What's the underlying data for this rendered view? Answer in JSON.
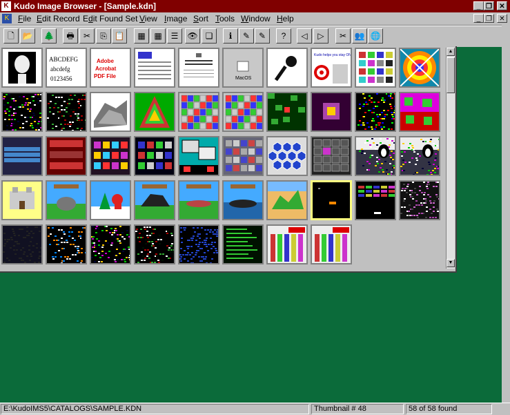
{
  "titlebar": {
    "title": "Kudo Image Browser - [Sample.kdn]",
    "minimize": "_",
    "restore": "❐",
    "close": "✕"
  },
  "menubar": {
    "items": [
      "File",
      "Edit Record",
      "Edit Found Set",
      "View",
      "Image",
      "Sort",
      "Tools",
      "Window",
      "Help"
    ],
    "mnemonics": [
      "F",
      "E",
      "d",
      "V",
      "I",
      "S",
      "T",
      "W",
      "H"
    ],
    "doc_minimize": "_",
    "doc_restore": "❐",
    "doc_close": "✕"
  },
  "toolbar": {
    "buttons": [
      {
        "name": "new-file",
        "glyph": "🗋"
      },
      {
        "name": "open-folder",
        "glyph": "📂"
      },
      {
        "name": "catalog",
        "glyph": "🌲"
      },
      {
        "name": "print",
        "glyph": "🖶"
      },
      {
        "name": "cut",
        "glyph": "✂"
      },
      {
        "name": "copy",
        "glyph": "⎘"
      },
      {
        "name": "paste",
        "glyph": "📋"
      },
      {
        "name": "thumbnail-view-large",
        "glyph": "▦"
      },
      {
        "name": "thumbnail-view-small",
        "glyph": "▦"
      },
      {
        "name": "list-view",
        "glyph": "☰"
      },
      {
        "name": "view-image",
        "glyph": "👁"
      },
      {
        "name": "stack",
        "glyph": "❏"
      },
      {
        "name": "info",
        "glyph": "ℹ"
      },
      {
        "name": "wand",
        "glyph": "✎"
      },
      {
        "name": "edit-pencil",
        "glyph": "✎"
      },
      {
        "name": "help-question",
        "glyph": "?"
      },
      {
        "name": "find-prev",
        "glyph": "◁"
      },
      {
        "name": "find-next",
        "glyph": "▷"
      },
      {
        "name": "tools",
        "glyph": "✂"
      },
      {
        "name": "people",
        "glyph": "👥"
      },
      {
        "name": "globe",
        "glyph": "🌐"
      }
    ]
  },
  "thumbnails": {
    "items": [
      "Einstein portrait",
      "Typeface sample",
      "Adobe Acrobat PDF File",
      "Document page",
      "Kudo Browser Multimedia Suite",
      "MacOS",
      "Microphone",
      "Kudo helps you stay ON TARGET!",
      "Color swatches",
      "Color wheel",
      "Dark noise game screen",
      "Dark noise game screen",
      "3D terrain",
      "Pyramid game",
      "Colored grid game",
      "Colored grid game",
      "Green maze",
      "Purple maze",
      "Colored confetti",
      "Green shapes puzzle",
      "Blue grid game",
      "Red bricks game",
      "Purple block game",
      "Dark block game",
      "Desktop windows",
      "Gray blocks game",
      "Blue hexagons",
      "Gray grid game",
      "Penguin game",
      "Penguin game",
      "Castle scene",
      "Elephant scene",
      "Santa scene",
      "Dinosaur scene",
      "Crocodile scene",
      "Whale scene",
      "Landscape scene",
      "Dark game (selected)",
      "Dark bricks game",
      "Dark purple game",
      "Dark yellow game",
      "Dark pixel game",
      "Dark pixel game",
      "Dark pixel game",
      "Dark blue pixel game",
      "Green text screen",
      "Colored bars game",
      "Colored bars game"
    ],
    "annotations": {
      "typeface": [
        "ABCDEFG",
        "abcdefg",
        "0123456"
      ],
      "pdf": [
        "Adobe",
        "Acrobat",
        "PDF File"
      ],
      "mac": "MacOS",
      "kudo_target": "Kudo helps you stay ON TARGET!"
    },
    "selected_index": 37
  },
  "statusbar": {
    "path": "E:\\KudoIMS5\\CATALOGS\\SAMPLE.KDN",
    "thumbnail": "Thumbnail # 48",
    "found": "58 of 58 found"
  },
  "colors": {
    "desktop": "#0b6b3a",
    "titlebar": "#800000",
    "chrome": "#c0c0c0",
    "selection": "#ffff80"
  }
}
